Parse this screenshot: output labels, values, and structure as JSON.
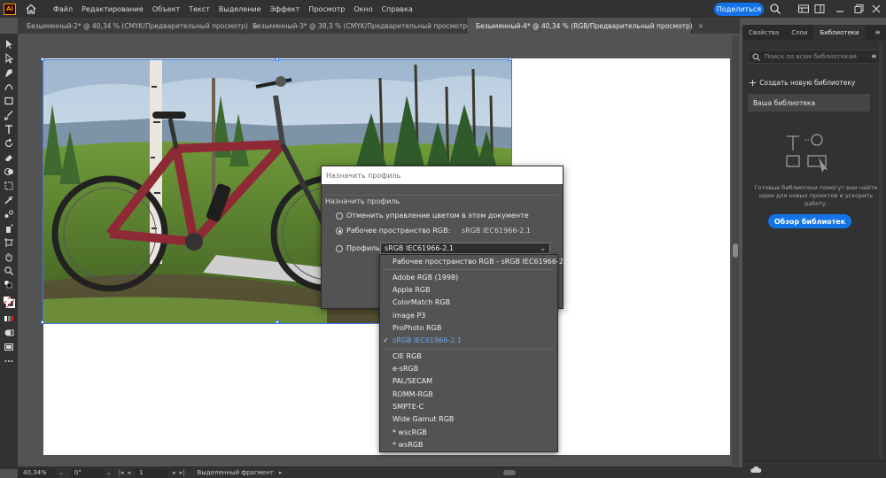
{
  "app": {
    "logo_text": "Ai"
  },
  "menu": [
    "Файл",
    "Редактирование",
    "Объект",
    "Текст",
    "Выделение",
    "Эффект",
    "Просмотр",
    "Окно",
    "Справка"
  ],
  "share_label": "Поделиться",
  "tabs": [
    {
      "label": "Безымянный-2* @ 40,34 % (CMYK/Предварительный просмотр)",
      "active": false
    },
    {
      "label": "Безымянный-3* @ 38,3 % (CMYK/Предварительный просмотр)",
      "active": false
    },
    {
      "label": "Безымянный-4* @ 40,34 % (RGB/Предварительный просмотр)",
      "active": true
    }
  ],
  "tab_close": "×",
  "right_panel": {
    "tabs": [
      "Свойства",
      "Слои",
      "Библиотеки"
    ],
    "search_placeholder": "Поиск по всем библиотекам",
    "create_label": "Создать новую библиотеку",
    "your_library": "Ваша библиотека",
    "empty_text": "Готовые библиотеки помогут вам найти идеи для новых проектов и ускорить работу.",
    "browse_button": "Обзор библиотек"
  },
  "dialog": {
    "title": "Назначить профиль",
    "section_label": "Назначить профиль",
    "option_1": "Отменить управление цветом в этом документе",
    "option_2_label": "Рабочее пространство RGB:",
    "option_2_value": "sRGB IEC61966-2.1",
    "option_3_label": "Профиль:",
    "profile_value": "sRGB IEC61966-2.1",
    "selected_option": 2
  },
  "dropdown": {
    "header_item": "Рабочее пространство RGB - sRGB IEC61966-2.1",
    "group_1": [
      "Adobe RGB (1998)",
      "Apple RGB",
      "ColorMatch RGB",
      "image P3",
      "ProPhoto RGB",
      "sRGB IEC61966-2.1"
    ],
    "group_2": [
      "CIE RGB",
      "e-sRGB",
      "PAL/SECAM",
      "ROMM-RGB",
      "SMPTE-C",
      "Wide Gamut RGB",
      "* wscRGB",
      "* wsRGB"
    ],
    "checked": "sRGB IEC61966-2.1"
  },
  "status": {
    "zoom": "40,34%",
    "rotation": "0°",
    "artboard": "1",
    "selection": "Выделенный фрагмент"
  },
  "colors": {
    "accent": "#1473e6",
    "selection": "#3d7be0",
    "checked_item": "#6aa8f0"
  }
}
